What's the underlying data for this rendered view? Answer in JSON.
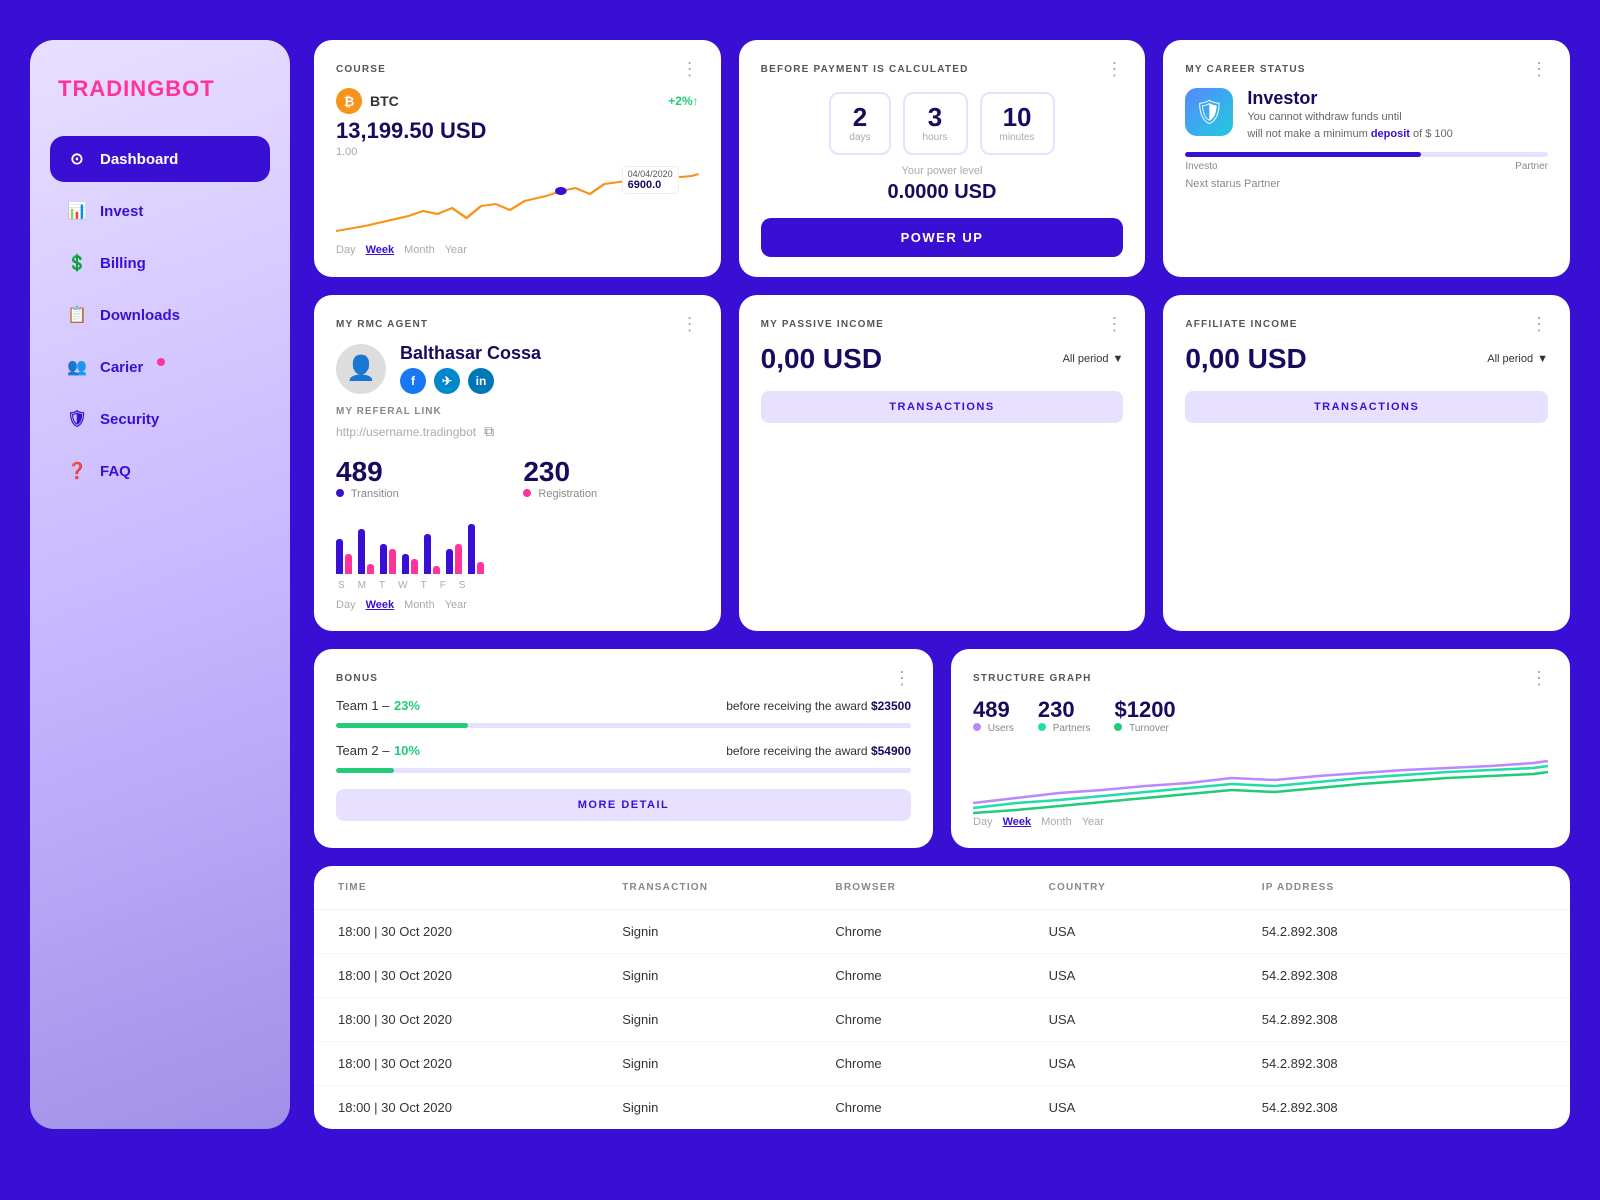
{
  "sidebar": {
    "logo": "TRADING",
    "logo_accent": "BOT",
    "items": [
      {
        "id": "dashboard",
        "label": "Dashboard",
        "icon": "⊙",
        "active": true
      },
      {
        "id": "invest",
        "label": "Invest",
        "icon": "📊"
      },
      {
        "id": "billing",
        "label": "Billing",
        "icon": "💲"
      },
      {
        "id": "downloads",
        "label": "Downloads",
        "icon": "📋"
      },
      {
        "id": "carier",
        "label": "Carier",
        "icon": "👥",
        "badge": true
      },
      {
        "id": "security",
        "label": "Security",
        "icon": "🛡"
      },
      {
        "id": "faq",
        "label": "FAQ",
        "icon": "❓"
      }
    ]
  },
  "course_card": {
    "title": "COURSE",
    "coin": "BTC",
    "price": "13,199.50 USD",
    "sub": "1.00",
    "change": "+2%↑",
    "tooltip_date": "04/04/2020",
    "tooltip_val": "6900.0",
    "time_tabs": [
      "Day",
      "Week",
      "Month",
      "Year"
    ],
    "active_tab": "Week"
  },
  "payment_card": {
    "title": "BEFORE PAYMENT IS CALCULATED",
    "days": "2",
    "days_label": "days",
    "hours": "3",
    "hours_label": "hours",
    "minutes": "10",
    "minutes_label": "minutes",
    "power_level_label": "Your power level",
    "power_level_val": "0.0000 USD",
    "power_up_btn": "POWER UP"
  },
  "career_card": {
    "title": "MY CAREER STATUS",
    "status": "Investor",
    "desc_1": "You cannot withdraw funds until",
    "desc_2": "will not make a minimum ",
    "deposit_link": "deposit",
    "deposit_amount": "of $ 100",
    "progress_pct": 65,
    "progress_from": "Investo",
    "progress_to": "Partner",
    "next_status": "Next starus Partner"
  },
  "rmc_card": {
    "title": "MY RMC AGENT",
    "agent_name": "Balthasar Cossa",
    "referal_label": "MY REFERAL LINK",
    "referal_url": "http://username.tradingbot",
    "stat1_num": "489",
    "stat1_label": "Transition",
    "stat1_color": "#3a0fd4",
    "stat2_num": "230",
    "stat2_label": "Registration",
    "stat2_color": "#ff3399",
    "time_tabs": [
      "Day",
      "Week",
      "Month",
      "Year"
    ],
    "active_tab": "Week",
    "days": [
      "S",
      "M",
      "T",
      "W",
      "T",
      "F",
      "S"
    ],
    "bars": [
      [
        35,
        20
      ],
      [
        45,
        10
      ],
      [
        30,
        25
      ],
      [
        20,
        15
      ],
      [
        40,
        8
      ],
      [
        25,
        30
      ],
      [
        50,
        12
      ]
    ]
  },
  "passive_income": {
    "title": "MY PASSIVE INCOME",
    "amount": "0,00 USD",
    "period": "All period",
    "transactions_btn": "TRANSACTIONS"
  },
  "affiliate_income": {
    "title": "AFFILIATE INCOME",
    "amount": "0,00 USD",
    "period": "All period",
    "transactions_btn": "TRANSACTIONS"
  },
  "bonus_card": {
    "title": "BONUS",
    "team1_label": "Team 1 –",
    "team1_pct": "23%",
    "team1_pct_color": "#22cc77",
    "team1_award": "before receiving the award",
    "team1_amount": "$23500",
    "team1_progress": 23,
    "team1_color": "#22cc77",
    "team2_label": "Team 2 –",
    "team2_pct": "10%",
    "team2_pct_color": "#22cc77",
    "team2_award": "before receiving the award",
    "team2_amount": "$54900",
    "team2_progress": 10,
    "team2_color": "#22cc77",
    "more_detail_btn": "MORE DETAIL"
  },
  "structure_card": {
    "title": "STRUCTURE GRAPH",
    "stat1_num": "489",
    "stat1_label": "Users",
    "stat1_color": "#bb88ff",
    "stat2_num": "230",
    "stat2_label": "Partners",
    "stat2_color": "#22ddaa",
    "stat3_num": "$1200",
    "stat3_label": "Turnover",
    "stat3_color": "#22cc77",
    "time_tabs": [
      "Day",
      "Week",
      "Month",
      "Year"
    ],
    "active_tab": "Week"
  },
  "activity_table": {
    "headers": [
      "TIME",
      "TRANSACTION",
      "BROWSER",
      "COUNTRY",
      "IP ADDRESS"
    ],
    "rows": [
      [
        "18:00 | 30 Oct 2020",
        "Signin",
        "Chrome",
        "USA",
        "54.2.892.308"
      ],
      [
        "18:00 | 30 Oct 2020",
        "Signin",
        "Chrome",
        "USA",
        "54.2.892.308"
      ],
      [
        "18:00 | 30 Oct 2020",
        "Signin",
        "Chrome",
        "USA",
        "54.2.892.308"
      ],
      [
        "18:00 | 30 Oct 2020",
        "Signin",
        "Chrome",
        "USA",
        "54.2.892.308"
      ],
      [
        "18:00 | 30 Oct 2020",
        "Signin",
        "Chrome",
        "USA",
        "54.2.892.308"
      ]
    ]
  }
}
